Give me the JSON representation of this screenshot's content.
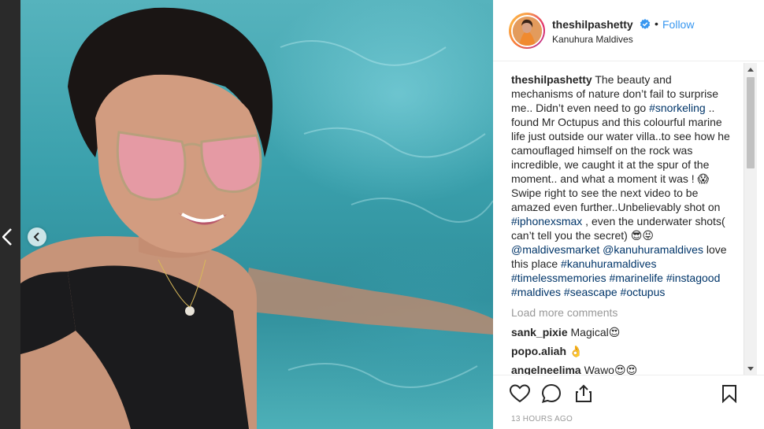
{
  "colors": {
    "link_blue": "#3897f0",
    "hashtag_blue": "#003569",
    "muted_gray": "#999999",
    "text_dark": "#262626",
    "verified_blue": "#3897f0"
  },
  "post": {
    "username": "theshilpashetty",
    "follow_label": "Follow",
    "separator": "•",
    "location": "Kanuhura Maldives",
    "caption": {
      "username": "theshilpashetty",
      "text_1": " The beauty and mechanisms of nature don’t fail to surprise me.. Didn’t even need to go ",
      "tag_snorkeling": "#snorkeling",
      "text_2": " .. found Mr Octupus and this colourful marine life just outside our water villa..to see how he camouflaged himself on the rock was incredible, we caught it at the spur of the moment.. and what a moment it was ! 😱 Swipe right to see the next video to be amazed even further..Unbelievably shot on ",
      "tag_iphonexsmax": "#iphonexsmax",
      "text_3": " , even the underwater shots( can’t tell you the secret) 😎😝 ",
      "mention_maldivesmarket": "@maldivesmarket",
      "text_4": " ",
      "mention_kanuhuramaldives": "@kanuhuramaldives",
      "text_5": " love this place ",
      "tag_kanuhuramaldives": "#kanuhuramaldives",
      "text_6": " ",
      "tag_timelessmemories": "#timelessmemories",
      "text_7": " ",
      "tag_marinelife": "#marinelife",
      "text_8": " ",
      "tag_instagood": "#instagood",
      "text_9": " ",
      "tag_maldives": "#maldives",
      "text_10": " ",
      "tag_seascape": "#seascape",
      "text_11": " ",
      "tag_octupus": "#octupus"
    },
    "load_more_label": "Load more comments",
    "comments": [
      {
        "user": "sank_pixie",
        "text": " Magical😍"
      },
      {
        "user": "popo.aliah",
        "text": " 👌"
      },
      {
        "user": "angelneelima",
        "text": " Wawo😍😍"
      }
    ],
    "timestamp": "13 HOURS AGO",
    "icons": {
      "like": "heart-icon",
      "comment": "comment-bubble-icon",
      "share": "share-icon",
      "save": "bookmark-icon",
      "verified": "verified-badge-icon"
    }
  }
}
